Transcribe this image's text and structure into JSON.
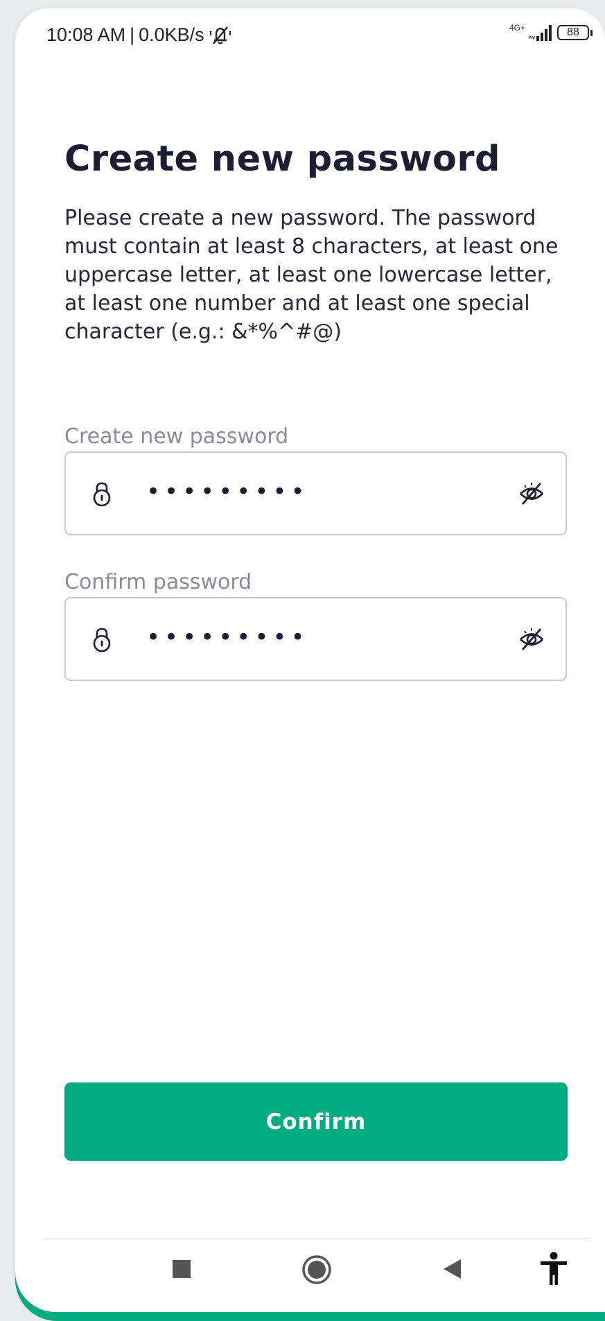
{
  "status_bar": {
    "time": "10:08 AM",
    "separator": "|",
    "network_speed": "0.0KB/s",
    "network_type": "4G+",
    "battery_level": "88",
    "icons": [
      "mute-icon",
      "signal-icon",
      "battery-icon"
    ]
  },
  "page": {
    "title": "Create new password",
    "description": "Please create a new password. The password must contain at least 8 characters, at least one uppercase letter, at least one lowercase letter, at least one number and at least one special character (e.g.: &*%^#@)"
  },
  "form": {
    "new_password": {
      "label": "Create new password",
      "value": "•••••••••",
      "icons": [
        "lock-icon",
        "eye-off-icon"
      ]
    },
    "confirm_password": {
      "label": "Confirm password",
      "value": "•••••••••",
      "icons": [
        "lock-icon",
        "eye-off-icon"
      ]
    },
    "confirm_button": {
      "label": "Confirm"
    }
  },
  "navigation_bar": {
    "icons": [
      "recents-square-icon",
      "home-circle-icon",
      "back-triangle-icon",
      "accessibility-icon"
    ]
  },
  "colors": {
    "accent": "#00ad80",
    "title_text": "#1d1d33",
    "label_text": "#8a8a9a",
    "field_border": "#c9c9d6"
  }
}
